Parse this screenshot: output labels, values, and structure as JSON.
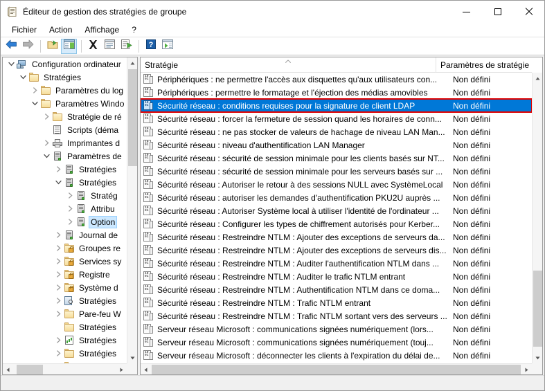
{
  "window": {
    "title": "Éditeur de gestion des stratégies de groupe",
    "title_icon": "policy-editor-icon",
    "minimize_label": "—",
    "maximize_label": "□",
    "close_label": "✕"
  },
  "menubar": {
    "items": [
      {
        "label": "Fichier",
        "name": "menu-fichier"
      },
      {
        "label": "Action",
        "name": "menu-action"
      },
      {
        "label": "Affichage",
        "name": "menu-affichage"
      },
      {
        "label": "?",
        "name": "menu-help"
      }
    ]
  },
  "toolbar": {
    "buttons": [
      {
        "name": "back-icon",
        "icon": "arrow-left",
        "pressed": false
      },
      {
        "name": "forward-icon",
        "icon": "arrow-right",
        "pressed": false
      },
      {
        "name": "up-folder-icon",
        "icon": "folder-up",
        "pressed": false
      },
      {
        "name": "show-hide-tree-icon",
        "icon": "window-tree",
        "pressed": true
      },
      {
        "name": "delete-icon",
        "icon": "x-black",
        "pressed": false
      },
      {
        "name": "properties-icon",
        "icon": "properties",
        "pressed": false
      },
      {
        "name": "export-list-icon",
        "icon": "export-list",
        "pressed": false
      },
      {
        "name": "help-icon",
        "icon": "question-blue",
        "pressed": false
      },
      {
        "name": "show-console-tree-icon",
        "icon": "window-play",
        "pressed": false
      }
    ]
  },
  "tree": {
    "nodes": [
      {
        "label": "Configuration ordinateur",
        "indent": 0,
        "twisty": "expanded",
        "icon": "computer-icon",
        "selected": false
      },
      {
        "label": "Stratégies",
        "indent": 1,
        "twisty": "expanded",
        "icon": "folder-icon",
        "selected": false
      },
      {
        "label": "Paramètres du log",
        "indent": 2,
        "twisty": "collapsed",
        "icon": "folder-icon",
        "selected": false
      },
      {
        "label": "Paramètres Windo",
        "indent": 2,
        "twisty": "expanded",
        "icon": "folder-icon",
        "selected": false
      },
      {
        "label": "Stratégie de ré",
        "indent": 3,
        "twisty": "collapsed",
        "icon": "folder-icon",
        "selected": false
      },
      {
        "label": "Scripts (déma",
        "indent": 3,
        "twisty": "none",
        "icon": "script-icon",
        "selected": false
      },
      {
        "label": "Imprimantes d",
        "indent": 3,
        "twisty": "collapsed",
        "icon": "printer-icon",
        "selected": false
      },
      {
        "label": "Paramètres de",
        "indent": 3,
        "twisty": "expanded",
        "icon": "security-settings-icon",
        "selected": false
      },
      {
        "label": "Stratégies",
        "indent": 4,
        "twisty": "collapsed",
        "icon": "server-icon",
        "selected": false
      },
      {
        "label": "Stratégies",
        "indent": 4,
        "twisty": "expanded",
        "icon": "server-icon",
        "selected": false
      },
      {
        "label": "Stratég",
        "indent": 5,
        "twisty": "collapsed",
        "icon": "server-icon",
        "selected": false
      },
      {
        "label": "Attribu",
        "indent": 5,
        "twisty": "collapsed",
        "icon": "server-icon",
        "selected": false
      },
      {
        "label": "Option",
        "indent": 5,
        "twisty": "collapsed",
        "icon": "server-icon",
        "selected": true
      },
      {
        "label": "Journal de",
        "indent": 4,
        "twisty": "collapsed",
        "icon": "server-icon",
        "selected": false
      },
      {
        "label": "Groupes re",
        "indent": 4,
        "twisty": "collapsed",
        "icon": "folder-lock-icon",
        "selected": false
      },
      {
        "label": "Services sy",
        "indent": 4,
        "twisty": "collapsed",
        "icon": "folder-lock-icon",
        "selected": false
      },
      {
        "label": "Registre",
        "indent": 4,
        "twisty": "collapsed",
        "icon": "folder-lock-icon",
        "selected": false
      },
      {
        "label": "Système d",
        "indent": 4,
        "twisty": "collapsed",
        "icon": "folder-lock-icon",
        "selected": false
      },
      {
        "label": "Stratégies",
        "indent": 4,
        "twisty": "collapsed",
        "icon": "magnify-icon",
        "selected": false
      },
      {
        "label": "Pare-feu W",
        "indent": 4,
        "twisty": "collapsed",
        "icon": "folder-icon",
        "selected": false
      },
      {
        "label": "Stratégies",
        "indent": 4,
        "twisty": "none",
        "icon": "folder-icon",
        "selected": false
      },
      {
        "label": "Stratégies",
        "indent": 4,
        "twisty": "collapsed",
        "icon": "chart-icon",
        "selected": false
      },
      {
        "label": "Stratégies",
        "indent": 4,
        "twisty": "collapsed",
        "icon": "folder-icon",
        "selected": false
      },
      {
        "label": "Stratégies",
        "indent": 4,
        "twisty": "collapsed",
        "icon": "folder-icon",
        "selected": false
      }
    ]
  },
  "list": {
    "columns": [
      {
        "label": "Stratégie",
        "name": "column-header-policy",
        "sort": "asc"
      },
      {
        "label": "Paramètres de stratégie",
        "name": "column-header-setting",
        "sort": "none"
      }
    ],
    "rows": [
      {
        "policy": "Périphériques : ne permettre l'accès aux disquettes qu'aux utilisateurs con...",
        "setting": "Non défini",
        "selected": false,
        "highlighted": false
      },
      {
        "policy": "Périphériques : permettre le formatage et l'éjection des médias amovibles",
        "setting": "Non défini",
        "selected": false,
        "highlighted": false
      },
      {
        "policy": "Sécurité réseau : conditions requises pour la signature de client LDAP",
        "setting": "Non défini",
        "selected": true,
        "highlighted": true
      },
      {
        "policy": "Sécurité réseau : forcer la fermeture de session quand les horaires de conn...",
        "setting": "Non défini",
        "selected": false,
        "highlighted": false
      },
      {
        "policy": "Sécurité réseau : ne pas stocker de valeurs de hachage de niveau LAN Man...",
        "setting": "Non défini",
        "selected": false,
        "highlighted": false
      },
      {
        "policy": "Sécurité réseau : niveau d'authentification LAN Manager",
        "setting": "Non défini",
        "selected": false,
        "highlighted": false
      },
      {
        "policy": "Sécurité réseau : sécurité de session minimale pour les clients basés sur NT...",
        "setting": "Non défini",
        "selected": false,
        "highlighted": false
      },
      {
        "policy": "Sécurité réseau : sécurité de session minimale pour les serveurs basés sur ...",
        "setting": "Non défini",
        "selected": false,
        "highlighted": false
      },
      {
        "policy": "Sécurité réseau : Autoriser le retour à des sessions NULL avec SystèmeLocal",
        "setting": "Non défini",
        "selected": false,
        "highlighted": false
      },
      {
        "policy": "Sécurité réseau : autoriser les demandes d'authentification PKU2U auprès ...",
        "setting": "Non défini",
        "selected": false,
        "highlighted": false
      },
      {
        "policy": "Sécurité réseau : Autoriser Système local à utiliser l'identité de l'ordinateur ...",
        "setting": "Non défini",
        "selected": false,
        "highlighted": false
      },
      {
        "policy": "Sécurité réseau : Configurer les types de chiffrement autorisés pour Kerber...",
        "setting": "Non défini",
        "selected": false,
        "highlighted": false
      },
      {
        "policy": "Sécurité réseau : Restreindre NTLM : Ajouter des exceptions de serveurs da...",
        "setting": "Non défini",
        "selected": false,
        "highlighted": false
      },
      {
        "policy": "Sécurité réseau : Restreindre NTLM : Ajouter des exceptions de serveurs dis...",
        "setting": "Non défini",
        "selected": false,
        "highlighted": false
      },
      {
        "policy": "Sécurité réseau : Restreindre NTLM : Auditer l'authentification NTLM dans ...",
        "setting": "Non défini",
        "selected": false,
        "highlighted": false
      },
      {
        "policy": "Sécurité réseau : Restreindre NTLM : Auditer le trafic NTLM entrant",
        "setting": "Non défini",
        "selected": false,
        "highlighted": false
      },
      {
        "policy": "Sécurité réseau : Restreindre NTLM : Authentification NTLM dans ce doma...",
        "setting": "Non défini",
        "selected": false,
        "highlighted": false
      },
      {
        "policy": "Sécurité réseau : Restreindre NTLM : Trafic NTLM entrant",
        "setting": "Non défini",
        "selected": false,
        "highlighted": false
      },
      {
        "policy": "Sécurité réseau : Restreindre NTLM : Trafic NTLM sortant vers des serveurs ...",
        "setting": "Non défini",
        "selected": false,
        "highlighted": false
      },
      {
        "policy": "Serveur réseau Microsoft : communications signées numériquement (lors...",
        "setting": "Non défini",
        "selected": false,
        "highlighted": false
      },
      {
        "policy": "Serveur réseau Microsoft : communications signées numériquement (touj...",
        "setting": "Non défini",
        "selected": false,
        "highlighted": false
      },
      {
        "policy": "Serveur réseau Microsoft : déconnecter les clients à l'expiration du délai de...",
        "setting": "Non défini",
        "selected": false,
        "highlighted": false
      }
    ]
  },
  "colors": {
    "selection": "#0078d7",
    "highlight_box": "#e00000",
    "window_bg": "#f0f0f0",
    "pane_bg": "#ffffff",
    "tree_selection": "#cce8ff"
  },
  "scrollbars": {
    "up_arrow": "▲",
    "down_arrow": "▼",
    "left_arrow": "◀",
    "right_arrow": "▶"
  }
}
